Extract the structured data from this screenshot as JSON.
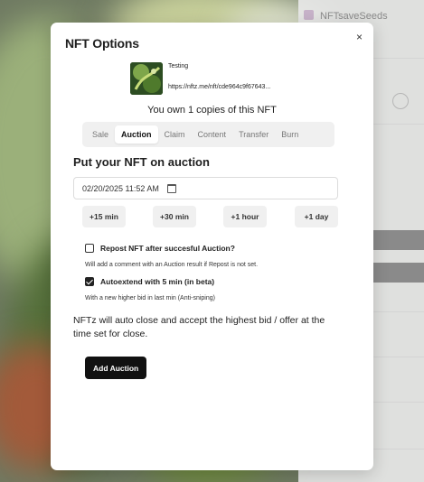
{
  "background": {
    "right_panel_title": "NFTsaveSeeds"
  },
  "modal": {
    "title": "NFT Options",
    "close_symbol": "×",
    "nft": {
      "name": "Testing",
      "url": "https://nftz.me/nft/cde964c9f67643..."
    },
    "ownership_text": "You own 1 copies of this NFT",
    "tabs": [
      {
        "label": "Sale",
        "active": false
      },
      {
        "label": "Auction",
        "active": true
      },
      {
        "label": "Claim",
        "active": false
      },
      {
        "label": "Content",
        "active": false
      },
      {
        "label": "Transfer",
        "active": false
      },
      {
        "label": "Burn",
        "active": false
      }
    ],
    "section_heading": "Put your NFT on auction",
    "datetime_value": "02/20/2025 11:52 AM",
    "quick_buttons": [
      "+15 min",
      "+30 min",
      "+1 hour",
      "+1 day"
    ],
    "repost": {
      "label": "Repost NFT after succesful Auction?",
      "checked": false,
      "note": "Will add a comment with an Auction result if Repost is not set."
    },
    "autoextend": {
      "label": "Autoextend with 5 min (in beta)",
      "checked": true,
      "note": "With a new higher bid in last min (Anti-sniping)"
    },
    "info_text": "NFTz will auto close and accept the highest bid / offer at the time set for close.",
    "submit_label": "Add Auction"
  },
  "icons": {
    "close": "close-icon",
    "calendar": "calendar-icon",
    "checkbox_checked": "checkmark-icon"
  }
}
